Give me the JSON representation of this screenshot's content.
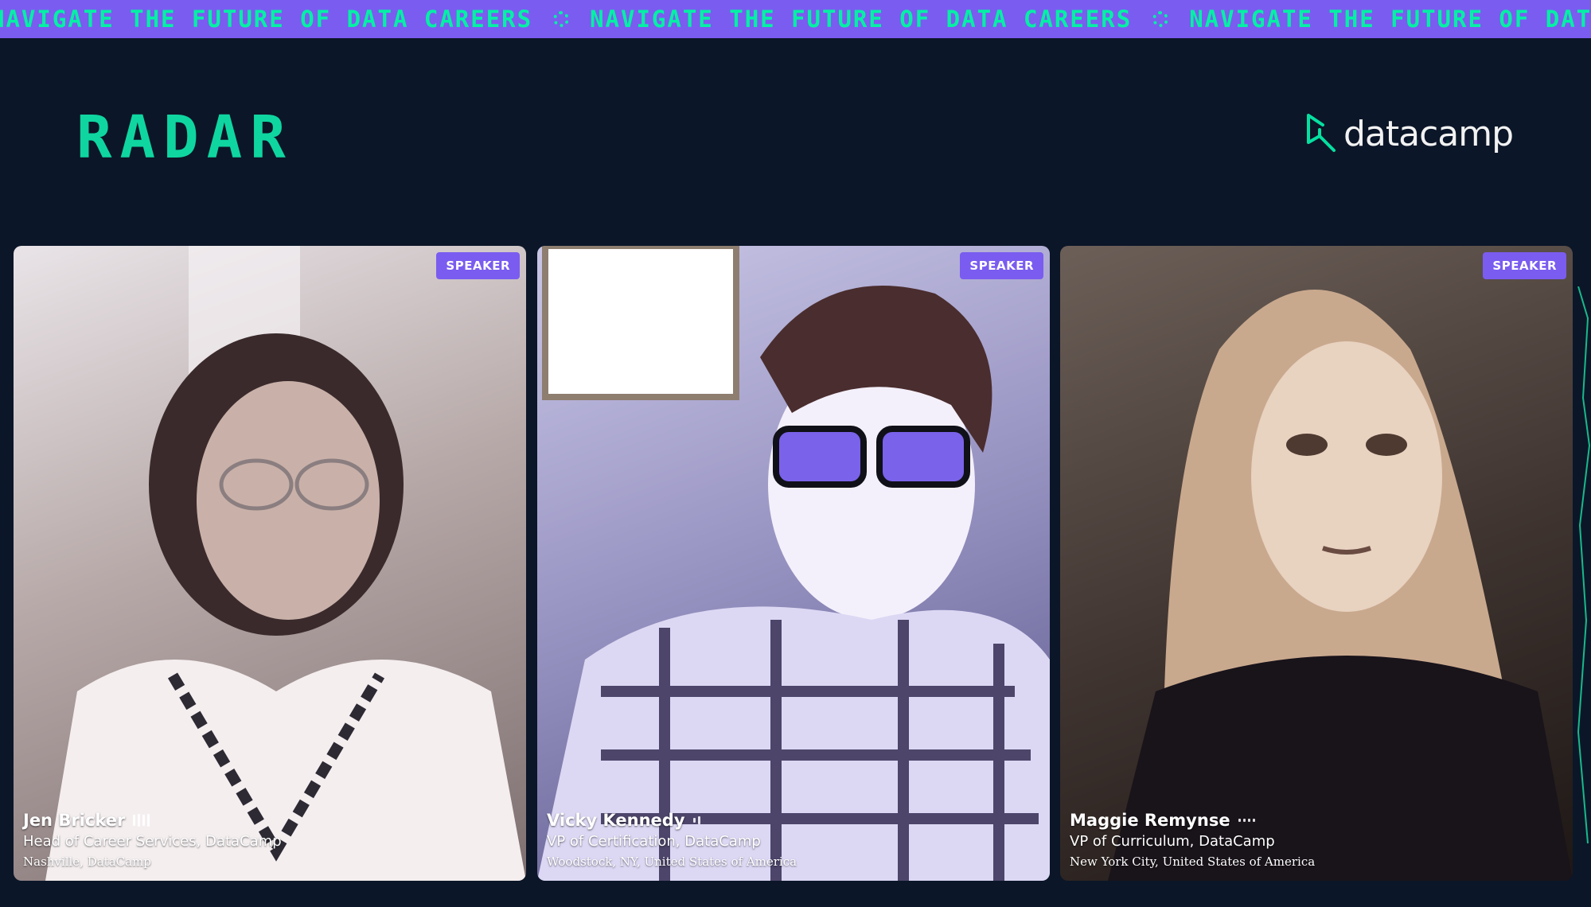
{
  "banner": {
    "text": "NAVIGATE THE FUTURE OF DATA CAREERS",
    "separator_icon": "sun-dots-icon"
  },
  "header": {
    "event_logo": "RADAR",
    "brand_logo": "datacamp"
  },
  "speakers": [
    {
      "badge": "SPEAKER",
      "name": "Jen Bricker",
      "role": "Head of Career Services, DataCamp",
      "location": "Nashville, DataCamp"
    },
    {
      "badge": "SPEAKER",
      "name": "Vicky Kennedy",
      "role": "VP of Certification, DataCamp",
      "location": "Woodstock, NY, United States of America"
    },
    {
      "badge": "SPEAKER",
      "name": "Maggie Remynse",
      "role": "VP of Curriculum, DataCamp",
      "location": "New York City, United States of America"
    }
  ],
  "colors": {
    "background": "#0b1628",
    "banner": "#7a5cf0",
    "banner_text": "#05f0a5",
    "radar_logo": "#0fd6a0",
    "badge": "#7a5cf0"
  }
}
